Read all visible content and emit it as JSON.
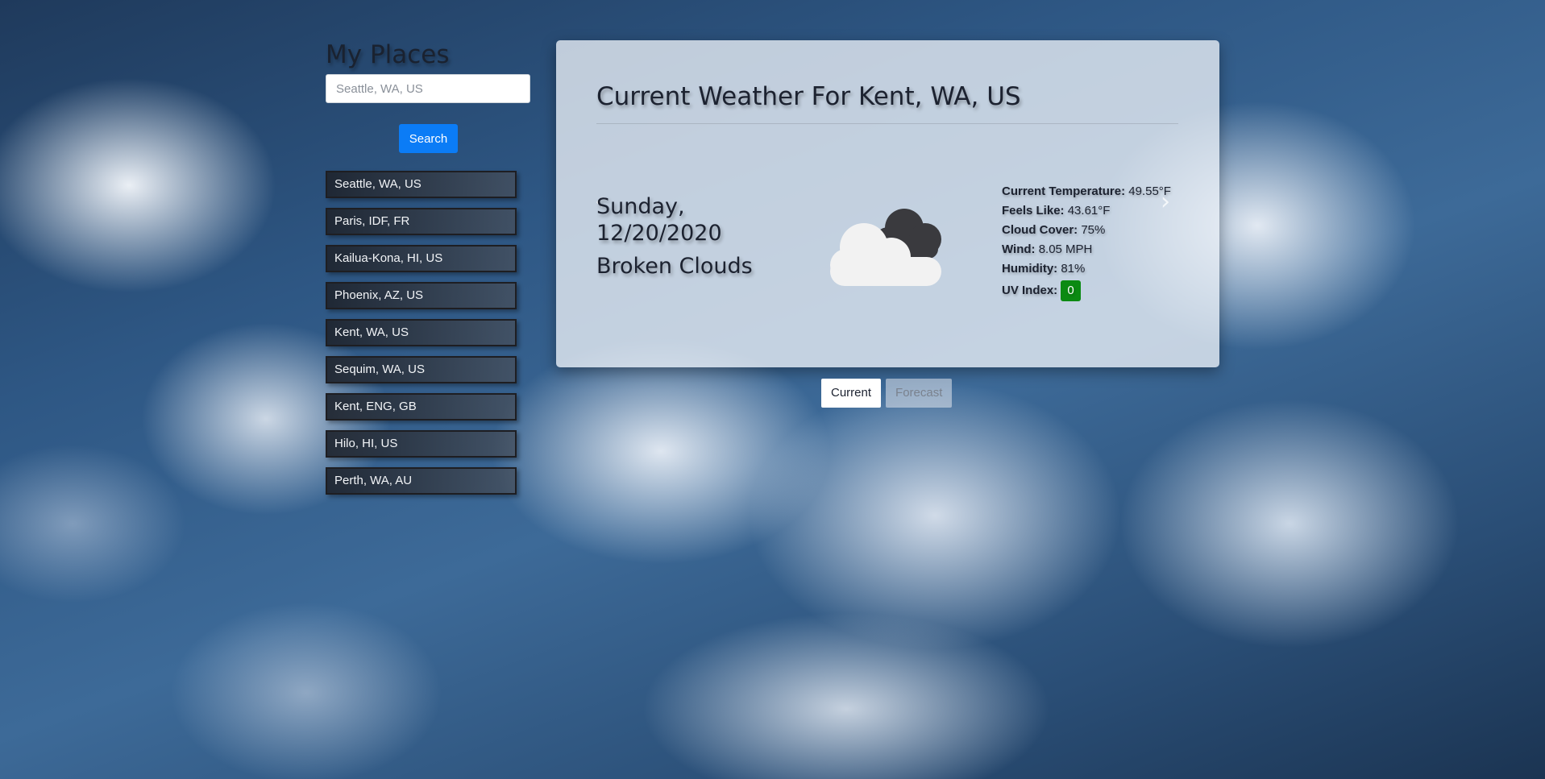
{
  "sidebar": {
    "title": "My Places",
    "search_placeholder": "Seattle, WA, US",
    "search_button": "Search",
    "places": [
      "Seattle, WA, US",
      "Paris, IDF, FR",
      "Kailua-Kona, HI, US",
      "Phoenix, AZ, US",
      "Kent, WA, US",
      "Sequim, WA, US",
      "Kent, ENG, GB",
      "Hilo, HI, US",
      "Perth, WA, AU"
    ]
  },
  "current": {
    "heading": "Current Weather For Kent, WA, US",
    "day": "Sunday,",
    "date": "12/20/2020",
    "condition": "Broken Clouds",
    "icon": "broken-clouds-icon",
    "stats": {
      "temperature_label": "Current Temperature:",
      "temperature_value": "49.55°F",
      "feels_like_label": "Feels Like:",
      "feels_like_value": "43.61°F",
      "cloud_cover_label": "Cloud Cover:",
      "cloud_cover_value": "75%",
      "wind_label": "Wind:",
      "wind_value": "8.05 MPH",
      "humidity_label": "Humidity:",
      "humidity_value": "81%",
      "uv_label": "UV Index:",
      "uv_value": "0"
    },
    "prev_glyph": "‹",
    "next_glyph": "›"
  },
  "tabs": {
    "current": "Current",
    "forecast": "Forecast"
  },
  "colors": {
    "search_button": "#0b7cf6",
    "uv_badge": "#0b8a12"
  }
}
